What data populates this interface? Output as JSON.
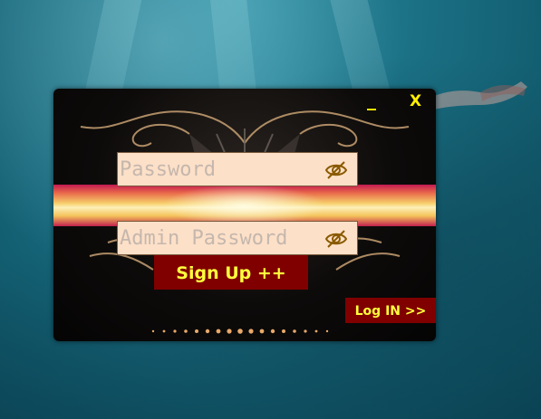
{
  "window": {
    "minimize_label": "_",
    "close_label": "X"
  },
  "password_field": {
    "placeholder": "Password",
    "value": "",
    "visibility_icon": "eye-slash-icon"
  },
  "admin_password_field": {
    "placeholder": "Admin Password",
    "value": "",
    "visibility_icon": "eye-slash-icon"
  },
  "signup_button": {
    "label": "Sign Up ++"
  },
  "login_button": {
    "label": "Log IN >>"
  },
  "colors": {
    "button_bg": "#800000",
    "button_text": "#ffff3c",
    "field_bg": "#fde0c8",
    "window_bg": "#0d0b0a"
  }
}
